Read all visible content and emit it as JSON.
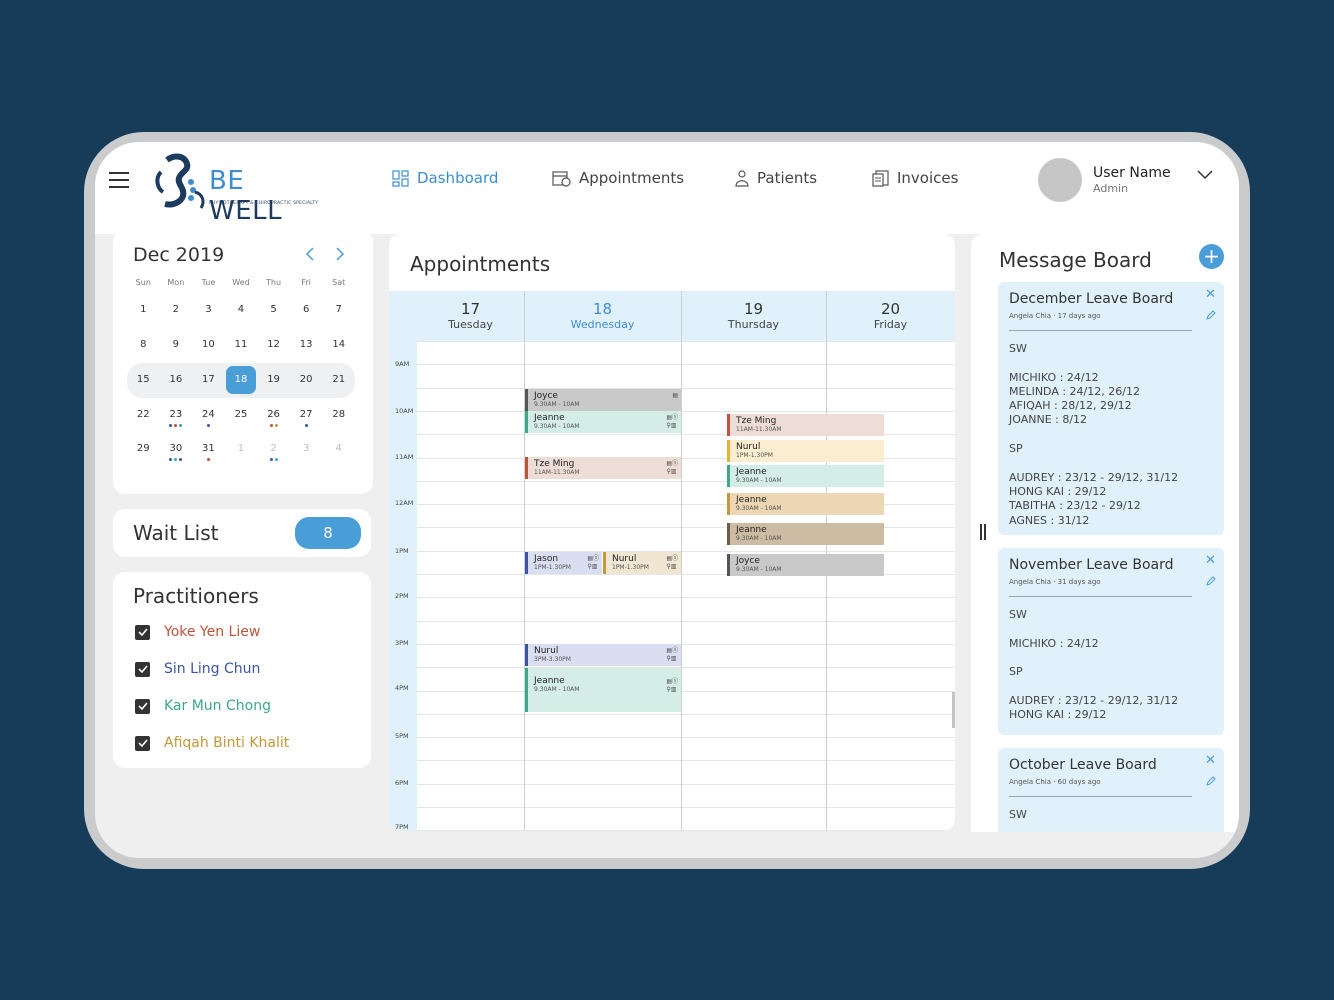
{
  "brand": {
    "name_be": "BE",
    "name_well": "WELL",
    "tagline": "PHYSIOTHERAPY & CHIROPRACTIC SPECIALTY"
  },
  "nav": [
    {
      "label": "Dashboard",
      "icon": "dashboard-icon",
      "active": true
    },
    {
      "label": "Appointments",
      "icon": "calendar-icon",
      "active": false
    },
    {
      "label": "Patients",
      "icon": "patient-icon",
      "active": false
    },
    {
      "label": "Invoices",
      "icon": "invoice-icon",
      "active": false
    }
  ],
  "user": {
    "name": "User Name",
    "role": "Admin"
  },
  "calendar": {
    "title": "Dec 2019",
    "dow": [
      "Sun",
      "Mon",
      "Tue",
      "Wed",
      "Thu",
      "Fri",
      "Sat"
    ],
    "weeks": [
      [
        "1",
        "2",
        "3",
        "4",
        "5",
        "6",
        "7"
      ],
      [
        "8",
        "9",
        "10",
        "11",
        "12",
        "13",
        "14"
      ],
      [
        "15",
        "16",
        "17",
        "18",
        "19",
        "20",
        "21"
      ],
      [
        "22",
        "23",
        "24",
        "25",
        "26",
        "27",
        "28"
      ],
      [
        "29",
        "30",
        "31",
        "1",
        "2",
        "3",
        "4"
      ]
    ],
    "selected": "18"
  },
  "waitlist": {
    "label": "Wait List",
    "count": "8"
  },
  "practitioners": {
    "title": "Practitioners",
    "items": [
      {
        "name": "Yoke Yen Liew",
        "color": "#c0533a"
      },
      {
        "name": "Sin Ling Chun",
        "color": "#3a55a4"
      },
      {
        "name": "Kar Mun Chong",
        "color": "#3aa98c"
      },
      {
        "name": "Afiqah Binti Khalit",
        "color": "#c5963a"
      }
    ]
  },
  "appointments": {
    "title": "Appointments",
    "days": [
      {
        "num": "17",
        "name": "Tuesday"
      },
      {
        "num": "18",
        "name": "Wednesday"
      },
      {
        "num": "19",
        "name": "Thursday"
      },
      {
        "num": "20",
        "name": "Friday"
      }
    ],
    "times": [
      "9AM",
      "10AM",
      "11AM",
      "12AM",
      "1PM",
      "2PM",
      "3PM",
      "4PM",
      "5PM",
      "6PM",
      "7PM"
    ],
    "events": [
      {
        "name": "Joyce",
        "time": "9.30AM - 10AM"
      },
      {
        "name": "Jeanne",
        "time": "9.30AM - 10AM"
      },
      {
        "name": "Tze Ming",
        "time": "11AM-11.30AM"
      },
      {
        "name": "Jason",
        "time": "1PM-1.30PM"
      },
      {
        "name": "Nurul",
        "time": "1PM-1.30PM"
      },
      {
        "name": "Nurul",
        "time": "3PM-3.30PM"
      },
      {
        "name": "Jeanne",
        "time": "9.30AM - 10AM"
      },
      {
        "name": "Tze Ming",
        "time": "11AM-11.30AM"
      },
      {
        "name": "Nurul",
        "time": "1PM-1.30PM"
      },
      {
        "name": "Jeanne",
        "time": "9.30AM - 10AM"
      },
      {
        "name": "Jeanne",
        "time": "9.30AM - 10AM"
      },
      {
        "name": "Jeanne",
        "time": "9.30AM - 10AM"
      },
      {
        "name": "Joyce",
        "time": "9.30AM - 10AM"
      }
    ]
  },
  "message_board": {
    "title": "Message Board",
    "cards": [
      {
        "title": "December Leave Board",
        "meta": "Angela Chia · 17 days ago",
        "body": "SW\n\nMICHIKO : 24/12\nMELINDA : 24/12, 26/12\nAFIQAH : 28/12, 29/12\nJOANNE : 8/12\n\nSP\n\nAUDREY : 23/12 - 29/12, 31/12\nHONG KAI : 29/12\nTABITHA : 23/12 - 29/12\nAGNES : 31/12"
      },
      {
        "title": "November Leave Board",
        "meta": "Angela Chia · 31 days ago",
        "body": "SW\n\nMICHIKO : 24/12\n\nSP\n\nAUDREY : 23/12 - 29/12, 31/12\nHONG KAI : 29/12"
      },
      {
        "title": "October Leave Board",
        "meta": "Angela Chia · 60 days ago",
        "body": "SW"
      }
    ]
  }
}
